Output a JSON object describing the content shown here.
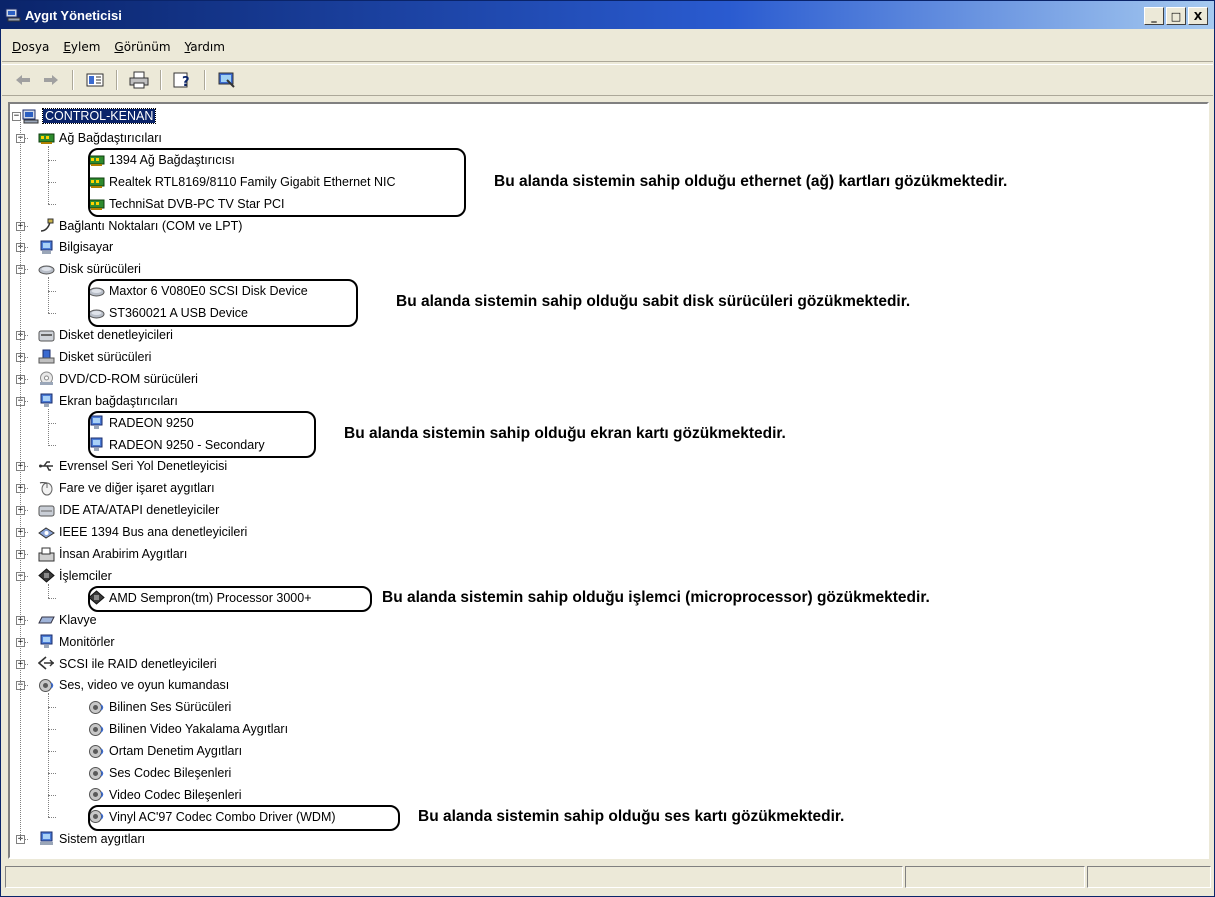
{
  "window": {
    "title": "Aygıt Yöneticisi",
    "minimize": "_",
    "maximize": "□",
    "close": "X"
  },
  "menu": [
    "Dosya",
    "Eylem",
    "Görünüm",
    "Yardım"
  ],
  "toolbar": [
    "back-icon",
    "forward-icon",
    "properties-icon",
    "print-icon",
    "help-icon",
    "scan-hardware-icon"
  ],
  "tree": {
    "root": "CONTROL-KENAN",
    "nodes": [
      {
        "label": "Ağ Bağdaştırıcıları",
        "expanded": true,
        "children": [
          "1394 Ağ Bağdaştırıcısı",
          "Realtek RTL8169/8110 Family Gigabit Ethernet NIC",
          "TechniSat DVB-PC TV Star PCI"
        ]
      },
      {
        "label": "Bağlantı Noktaları (COM ve LPT)"
      },
      {
        "label": "Bilgisayar"
      },
      {
        "label": "Disk sürücüleri",
        "expanded": true,
        "children": [
          "Maxtor 6 V080E0 SCSI Disk Device",
          "ST360021 A USB Device"
        ]
      },
      {
        "label": "Disket denetleyicileri"
      },
      {
        "label": "Disket sürücüleri"
      },
      {
        "label": "DVD/CD-ROM sürücüleri"
      },
      {
        "label": "Ekran bağdaştırıcıları",
        "expanded": true,
        "children": [
          "RADEON 9250",
          "RADEON 9250 - Secondary"
        ]
      },
      {
        "label": "Evrensel Seri Yol Denetleyicisi"
      },
      {
        "label": "Fare ve diğer işaret aygıtları"
      },
      {
        "label": "IDE ATA/ATAPI denetleyiciler"
      },
      {
        "label": "IEEE 1394 Bus ana denetleyicileri"
      },
      {
        "label": "İnsan Arabirim Aygıtları"
      },
      {
        "label": "İşlemciler",
        "expanded": true,
        "children": [
          "AMD Sempron(tm) Processor 3000+"
        ]
      },
      {
        "label": "Klavye"
      },
      {
        "label": "Monitörler"
      },
      {
        "label": "SCSI ile RAID denetleyicileri"
      },
      {
        "label": "Ses, video ve oyun kumandası",
        "expanded": true,
        "children": [
          "Bilinen Ses Sürücüleri",
          "Bilinen Video Yakalama Aygıtları",
          "Ortam Denetim Aygıtları",
          "Ses Codec Bileşenleri",
          "Video Codec Bileşenleri",
          "Vinyl AC'97 Codec Combo Driver (WDM)"
        ]
      },
      {
        "label": "Sistem aygıtları"
      }
    ]
  },
  "annotations": {
    "network": "Bu alanda sistemin sahip olduğu ethernet (ağ) kartları gözükmektedir.",
    "disk": "Bu alanda sistemin sahip olduğu sabit disk sürücüleri gözükmektedir.",
    "display": "Bu alanda sistemin sahip olduğu ekran kartı gözükmektedir.",
    "cpu": "Bu alanda sistemin sahip olduğu işlemci (microprocessor) gözükmektedir.",
    "sound": "Bu alanda sistemin sahip olduğu ses kartı gözükmektedir."
  }
}
